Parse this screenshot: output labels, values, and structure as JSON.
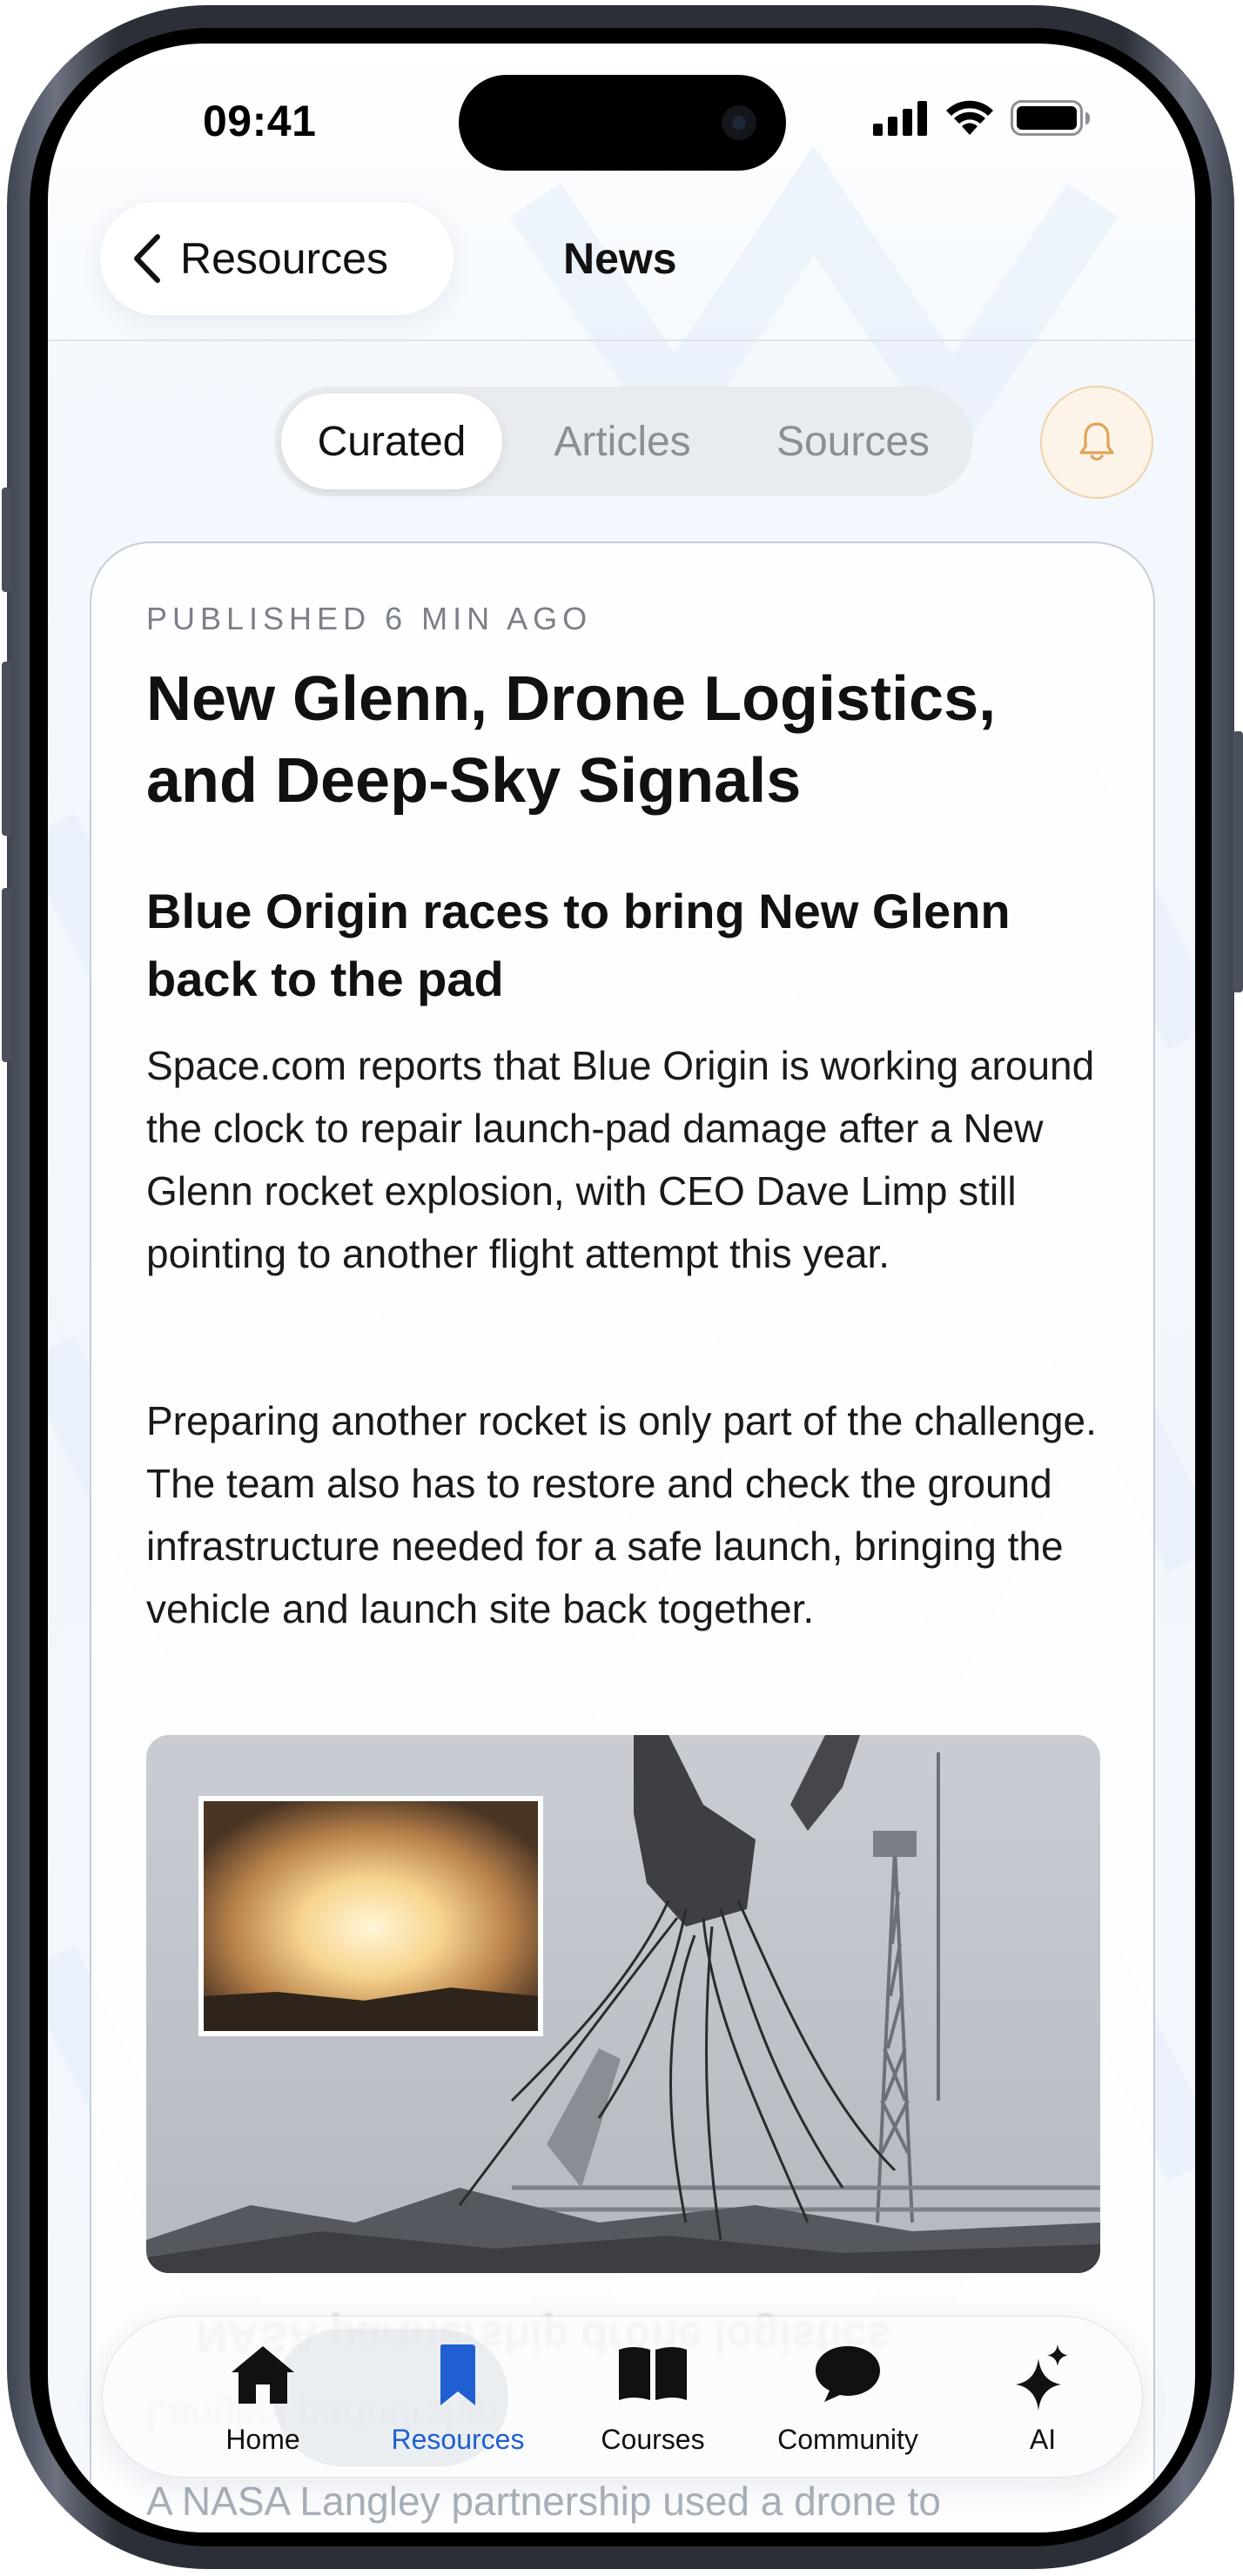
{
  "status_bar": {
    "time": "09:41"
  },
  "nav": {
    "back_label": "Resources",
    "title": "News"
  },
  "segments": [
    "Curated",
    "Articles",
    "Sources"
  ],
  "segment_selected": "Curated",
  "article": {
    "published": "PUBLISHED 6 MIN AGO",
    "headline": "New Glenn, Drone Logistics, and Deep-Sky Signals",
    "subhead": "Blue Origin races to bring New Glenn back to the pad",
    "paragraphs": [
      "Space.com reports that Blue Origin is working around the clock to repair launch-pad damage after a New Glenn rocket explosion, with CEO Dave Limp still pointing to another flight attempt this year.",
      "Preparing another rocket is only part of the challenge. The team also has to restore and check the ground infrastructure needed for a safe launch, bringing the vehicle and launch site back together."
    ],
    "next_preview": "A NASA Langley partnership used a drone to"
  },
  "tabbar": {
    "tabs": [
      {
        "label": "Home",
        "icon": "home-icon"
      },
      {
        "label": "Resources",
        "icon": "bookmark-icon"
      },
      {
        "label": "Courses",
        "icon": "book-icon"
      },
      {
        "label": "Community",
        "icon": "chat-bubble-icon"
      },
      {
        "label": "AI",
        "icon": "sparkles-icon"
      }
    ],
    "selected": "Resources"
  },
  "colors": {
    "accent": "#1f5fd1",
    "bell_bg": "#fcf4e8",
    "bell_border": "#efd2a8",
    "bell_icon": "#e0a45a"
  }
}
